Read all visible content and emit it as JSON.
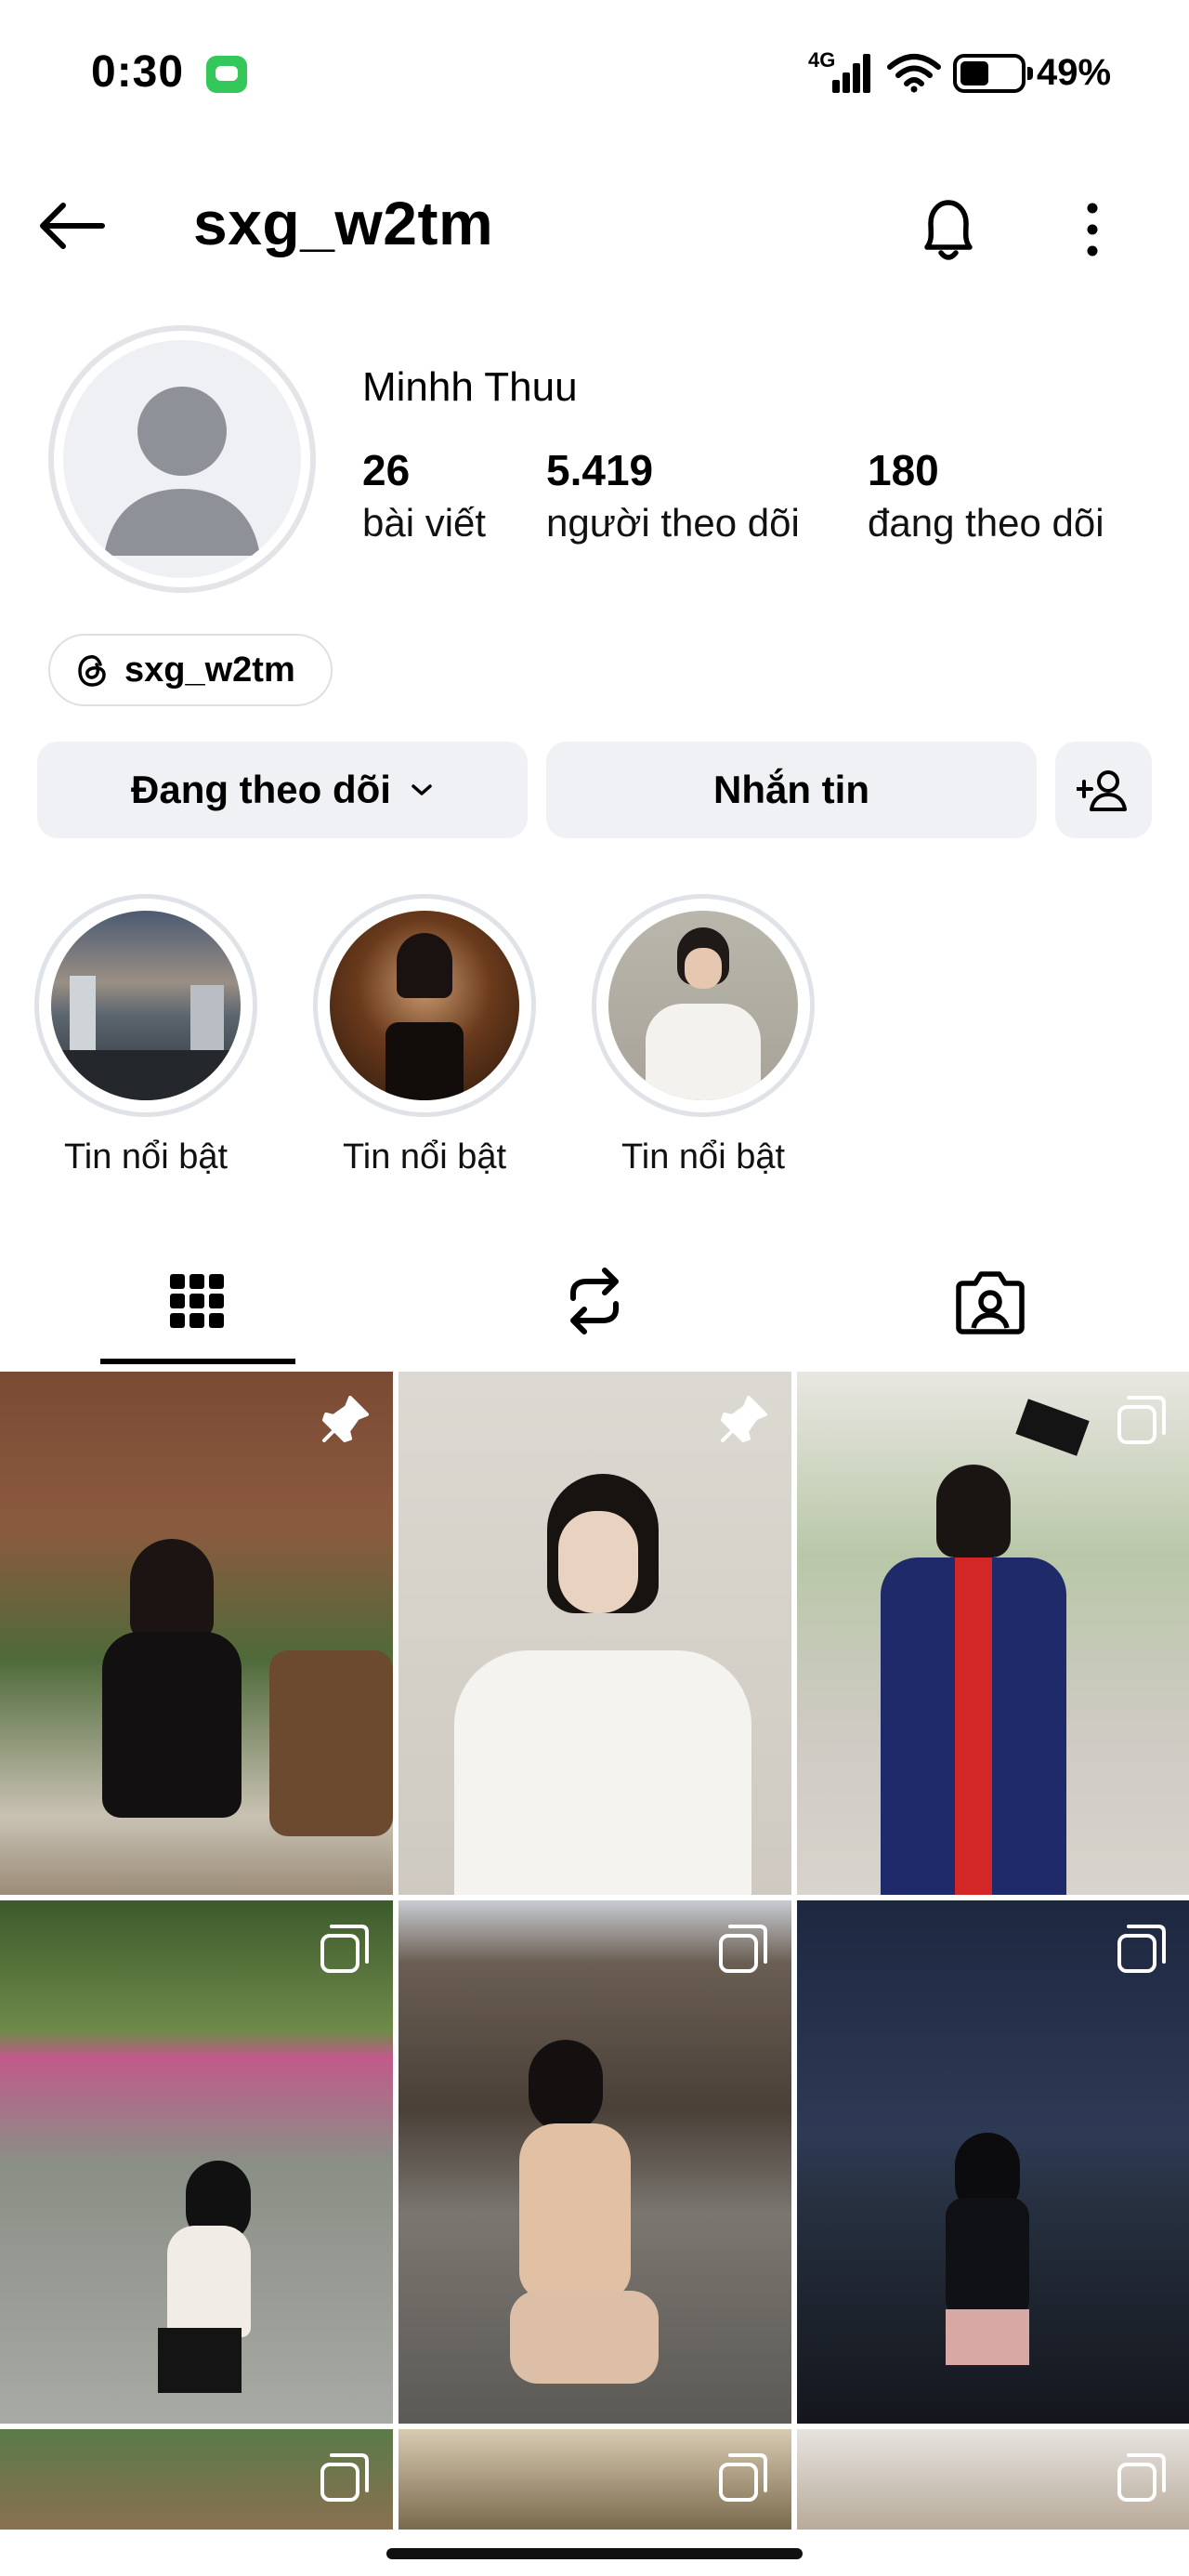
{
  "status_bar": {
    "time": "0:30",
    "network": "4G",
    "battery_percent": "49%",
    "battery_level": 0.49
  },
  "header": {
    "username": "sxg_w2tm"
  },
  "profile": {
    "display_name": "Minhh Thuu",
    "stats": [
      {
        "value": "26",
        "label": "bài viết"
      },
      {
        "value": "5.419",
        "label": "người theo dõi"
      },
      {
        "value": "180",
        "label": "đang theo dõi"
      }
    ],
    "threads_handle": "sxg_w2tm"
  },
  "actions": {
    "following_label": "Đang theo dõi",
    "message_label": "Nhắn tin"
  },
  "highlights": [
    {
      "label": "Tin nổi bật"
    },
    {
      "label": "Tin nổi bật"
    },
    {
      "label": "Tin nổi bật"
    }
  ],
  "tabs": [
    "posts-grid",
    "reposts",
    "tagged"
  ],
  "colors": {
    "button_bg": "#eff1f4",
    "status_green": "#34c759",
    "accent": "#000000"
  }
}
